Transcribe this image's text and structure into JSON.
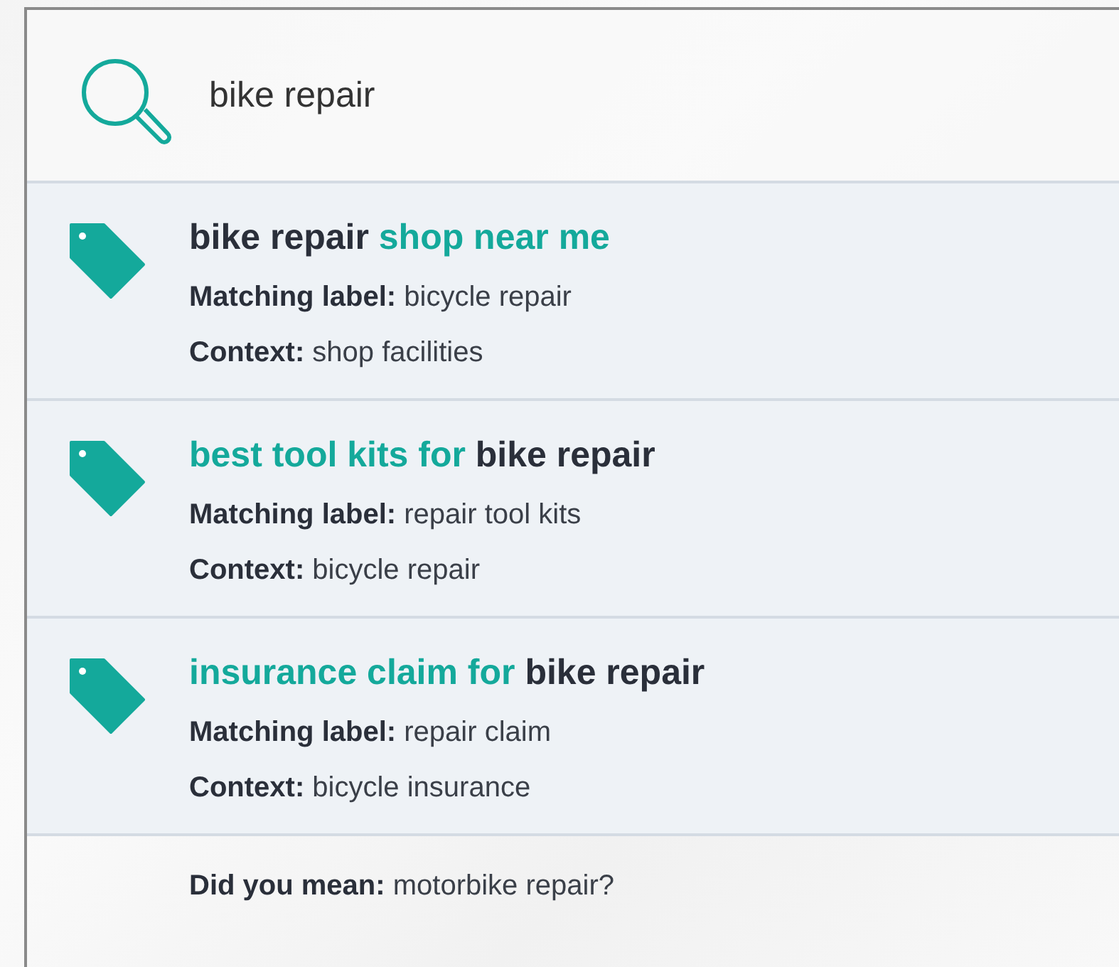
{
  "search": {
    "value": "bike repair"
  },
  "results": [
    {
      "title": [
        {
          "text": "bike repair",
          "matched": true
        },
        {
          "text": " shop near me",
          "matched": false
        }
      ],
      "lines": [
        "**Matching label:** bicycle repair",
        "**Context:** shop facilities"
      ]
    },
    {
      "title": [
        {
          "text": "best tool kits for ",
          "matched": false
        },
        {
          "text": "bike repair",
          "matched": true
        }
      ],
      "lines": [
        "**Matching label:** repair tool kits",
        "**Context:** bicycle repair"
      ]
    },
    {
      "title": [
        {
          "text": "insurance claim for ",
          "matched": false
        },
        {
          "text": "bike repair",
          "matched": true
        }
      ],
      "lines": [
        "**Matching label:** repair claim",
        "**Context:** bicycle insurance"
      ]
    }
  ],
  "suggestion": "**Did you mean:** motorbike repair?"
}
